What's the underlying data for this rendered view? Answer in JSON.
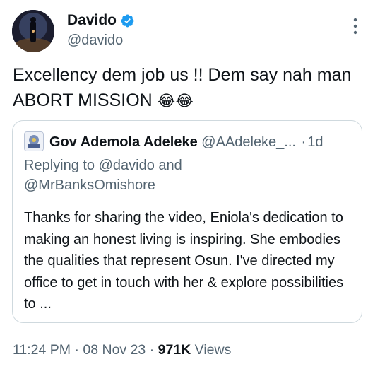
{
  "author": {
    "name": "Davido",
    "handle": "@davido",
    "verified": true,
    "verified_color": "#1d9bf0"
  },
  "tweet": {
    "text": "Excellency dem job us !! Dem say nah man ABORT MISSION",
    "emojis": "😂😂"
  },
  "quoted_tweet": {
    "name": "Gov Ademola Adeleke",
    "handle": "@AAdeleke_...",
    "separator": "·",
    "time": "1d",
    "reply_line_1": "Replying to @davido and",
    "reply_line_2": "@MrBanksOmishore",
    "body": "Thanks for sharing the video, Eniola's dedication to making an honest living is inspiring. She embodies the qualities that represent Osun. I've directed my office to get in touch with her & explore possibilities to ..."
  },
  "meta": {
    "time": "11:24 PM",
    "sep1": "·",
    "date": "08 Nov 23",
    "sep2": "·",
    "views_count": "971K",
    "views_label": "Views"
  },
  "icons": {
    "verified": "verified-badge-icon",
    "more": "more-options-icon"
  }
}
